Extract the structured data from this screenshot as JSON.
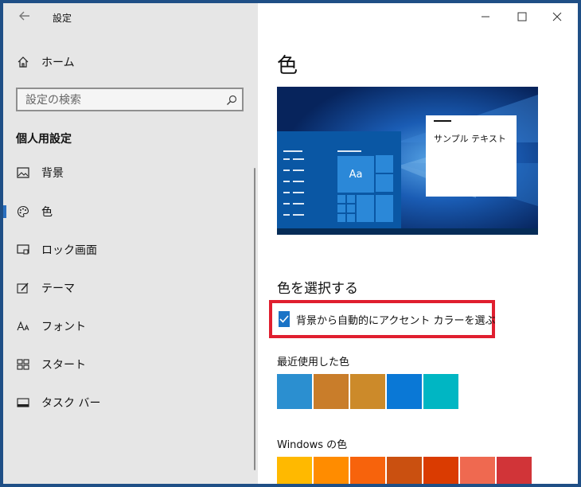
{
  "app": {
    "title": "設定"
  },
  "sidebar": {
    "home_label": "ホーム",
    "search_placeholder": "設定の検索",
    "section_title": "個人用設定",
    "items": [
      {
        "label": "背景",
        "icon": "image-icon"
      },
      {
        "label": "色",
        "icon": "palette-icon",
        "active": true
      },
      {
        "label": "ロック画面",
        "icon": "lock-screen-icon"
      },
      {
        "label": "テーマ",
        "icon": "theme-icon"
      },
      {
        "label": "フォント",
        "icon": "font-icon"
      },
      {
        "label": "スタート",
        "icon": "start-icon"
      },
      {
        "label": "タスク バー",
        "icon": "taskbar-icon"
      }
    ]
  },
  "main": {
    "page_title": "色",
    "preview_sample_text": "サンプル テキスト",
    "preview_tile_text": "Aa",
    "choose_heading": "色を選択する",
    "auto_accent_label": "背景から自動的にアクセント カラーを選ぶ",
    "auto_accent_checked": true,
    "recent_colors_label": "最近使用した色",
    "recent_colors": [
      "#2b8fd0",
      "#c97d2a",
      "#cc8a2a",
      "#0a78d6",
      "#00b6c3"
    ],
    "windows_colors_label": "Windows の色",
    "windows_colors": [
      "#ffb900",
      "#ff8c00",
      "#f7630c",
      "#ca5010",
      "#da3b01",
      "#ef6950",
      "#d13438"
    ]
  },
  "colors": {
    "accent": "#1a73c6",
    "highlight_border": "#e01f2f",
    "sidebar_bg": "#e6e6e6"
  }
}
